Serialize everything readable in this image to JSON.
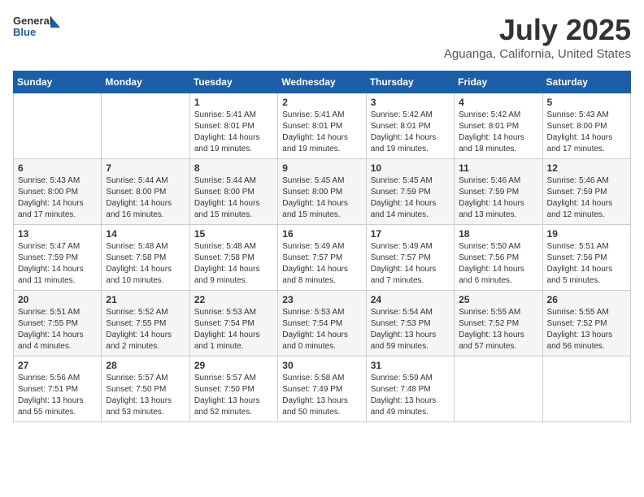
{
  "header": {
    "logo": {
      "general": "General",
      "blue": "Blue"
    },
    "month": "July 2025",
    "location": "Aguanga, California, United States"
  },
  "weekdays": [
    "Sunday",
    "Monday",
    "Tuesday",
    "Wednesday",
    "Thursday",
    "Friday",
    "Saturday"
  ],
  "weeks": [
    [
      {
        "day": "",
        "info": ""
      },
      {
        "day": "",
        "info": ""
      },
      {
        "day": "1",
        "info": "Sunrise: 5:41 AM\nSunset: 8:01 PM\nDaylight: 14 hours and 19 minutes."
      },
      {
        "day": "2",
        "info": "Sunrise: 5:41 AM\nSunset: 8:01 PM\nDaylight: 14 hours and 19 minutes."
      },
      {
        "day": "3",
        "info": "Sunrise: 5:42 AM\nSunset: 8:01 PM\nDaylight: 14 hours and 19 minutes."
      },
      {
        "day": "4",
        "info": "Sunrise: 5:42 AM\nSunset: 8:01 PM\nDaylight: 14 hours and 18 minutes."
      },
      {
        "day": "5",
        "info": "Sunrise: 5:43 AM\nSunset: 8:00 PM\nDaylight: 14 hours and 17 minutes."
      }
    ],
    [
      {
        "day": "6",
        "info": "Sunrise: 5:43 AM\nSunset: 8:00 PM\nDaylight: 14 hours and 17 minutes."
      },
      {
        "day": "7",
        "info": "Sunrise: 5:44 AM\nSunset: 8:00 PM\nDaylight: 14 hours and 16 minutes."
      },
      {
        "day": "8",
        "info": "Sunrise: 5:44 AM\nSunset: 8:00 PM\nDaylight: 14 hours and 15 minutes."
      },
      {
        "day": "9",
        "info": "Sunrise: 5:45 AM\nSunset: 8:00 PM\nDaylight: 14 hours and 15 minutes."
      },
      {
        "day": "10",
        "info": "Sunrise: 5:45 AM\nSunset: 7:59 PM\nDaylight: 14 hours and 14 minutes."
      },
      {
        "day": "11",
        "info": "Sunrise: 5:46 AM\nSunset: 7:59 PM\nDaylight: 14 hours and 13 minutes."
      },
      {
        "day": "12",
        "info": "Sunrise: 5:46 AM\nSunset: 7:59 PM\nDaylight: 14 hours and 12 minutes."
      }
    ],
    [
      {
        "day": "13",
        "info": "Sunrise: 5:47 AM\nSunset: 7:59 PM\nDaylight: 14 hours and 11 minutes."
      },
      {
        "day": "14",
        "info": "Sunrise: 5:48 AM\nSunset: 7:58 PM\nDaylight: 14 hours and 10 minutes."
      },
      {
        "day": "15",
        "info": "Sunrise: 5:48 AM\nSunset: 7:58 PM\nDaylight: 14 hours and 9 minutes."
      },
      {
        "day": "16",
        "info": "Sunrise: 5:49 AM\nSunset: 7:57 PM\nDaylight: 14 hours and 8 minutes."
      },
      {
        "day": "17",
        "info": "Sunrise: 5:49 AM\nSunset: 7:57 PM\nDaylight: 14 hours and 7 minutes."
      },
      {
        "day": "18",
        "info": "Sunrise: 5:50 AM\nSunset: 7:56 PM\nDaylight: 14 hours and 6 minutes."
      },
      {
        "day": "19",
        "info": "Sunrise: 5:51 AM\nSunset: 7:56 PM\nDaylight: 14 hours and 5 minutes."
      }
    ],
    [
      {
        "day": "20",
        "info": "Sunrise: 5:51 AM\nSunset: 7:55 PM\nDaylight: 14 hours and 4 minutes."
      },
      {
        "day": "21",
        "info": "Sunrise: 5:52 AM\nSunset: 7:55 PM\nDaylight: 14 hours and 2 minutes."
      },
      {
        "day": "22",
        "info": "Sunrise: 5:53 AM\nSunset: 7:54 PM\nDaylight: 14 hours and 1 minute."
      },
      {
        "day": "23",
        "info": "Sunrise: 5:53 AM\nSunset: 7:54 PM\nDaylight: 14 hours and 0 minutes."
      },
      {
        "day": "24",
        "info": "Sunrise: 5:54 AM\nSunset: 7:53 PM\nDaylight: 13 hours and 59 minutes."
      },
      {
        "day": "25",
        "info": "Sunrise: 5:55 AM\nSunset: 7:52 PM\nDaylight: 13 hours and 57 minutes."
      },
      {
        "day": "26",
        "info": "Sunrise: 5:55 AM\nSunset: 7:52 PM\nDaylight: 13 hours and 56 minutes."
      }
    ],
    [
      {
        "day": "27",
        "info": "Sunrise: 5:56 AM\nSunset: 7:51 PM\nDaylight: 13 hours and 55 minutes."
      },
      {
        "day": "28",
        "info": "Sunrise: 5:57 AM\nSunset: 7:50 PM\nDaylight: 13 hours and 53 minutes."
      },
      {
        "day": "29",
        "info": "Sunrise: 5:57 AM\nSunset: 7:50 PM\nDaylight: 13 hours and 52 minutes."
      },
      {
        "day": "30",
        "info": "Sunrise: 5:58 AM\nSunset: 7:49 PM\nDaylight: 13 hours and 50 minutes."
      },
      {
        "day": "31",
        "info": "Sunrise: 5:59 AM\nSunset: 7:48 PM\nDaylight: 13 hours and 49 minutes."
      },
      {
        "day": "",
        "info": ""
      },
      {
        "day": "",
        "info": ""
      }
    ]
  ]
}
